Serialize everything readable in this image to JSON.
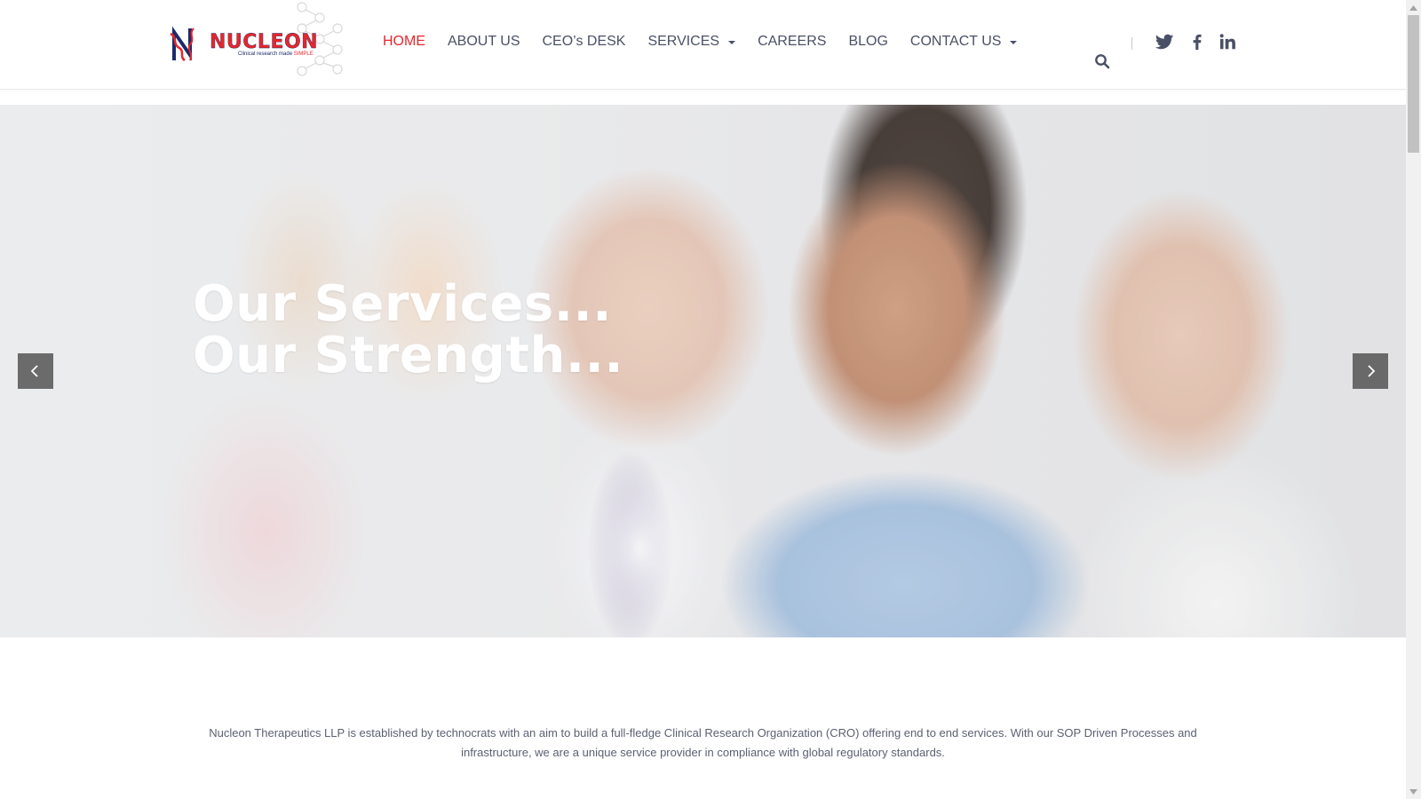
{
  "brand": {
    "name": "NUCLEON",
    "tagline_prefix": "Clinical research made ",
    "tagline_highlight": "SIMPLE"
  },
  "nav": {
    "items": [
      {
        "label": "HOME",
        "active": true,
        "dropdown": false
      },
      {
        "label": "ABOUT US",
        "active": false,
        "dropdown": false
      },
      {
        "label": "CEO’s DESK",
        "active": false,
        "dropdown": false
      },
      {
        "label": "SERVICES",
        "active": false,
        "dropdown": true
      },
      {
        "label": "CAREERS",
        "active": false,
        "dropdown": false
      },
      {
        "label": "BLOG",
        "active": false,
        "dropdown": false
      },
      {
        "label": "CONTACT US",
        "active": false,
        "dropdown": true
      }
    ]
  },
  "header_icons": [
    "search-icon",
    "twitter-icon",
    "facebook-icon",
    "linkedin-icon"
  ],
  "hero": {
    "line1": "Our Services...",
    "line2": "Our Strength..."
  },
  "intro": {
    "text": "Nucleon Therapeutics LLP is established by technocrats with an aim to build a full-fledge Clinical Research Organization (CRO) offering end to end services. With our SOP Driven Processes and infrastructure, we are a unique service provider in compliance with global regulatory standards."
  },
  "colors": {
    "accent": "#e8262a",
    "nav_text": "#4a5066",
    "brand_navy": "#1c2a6b"
  }
}
